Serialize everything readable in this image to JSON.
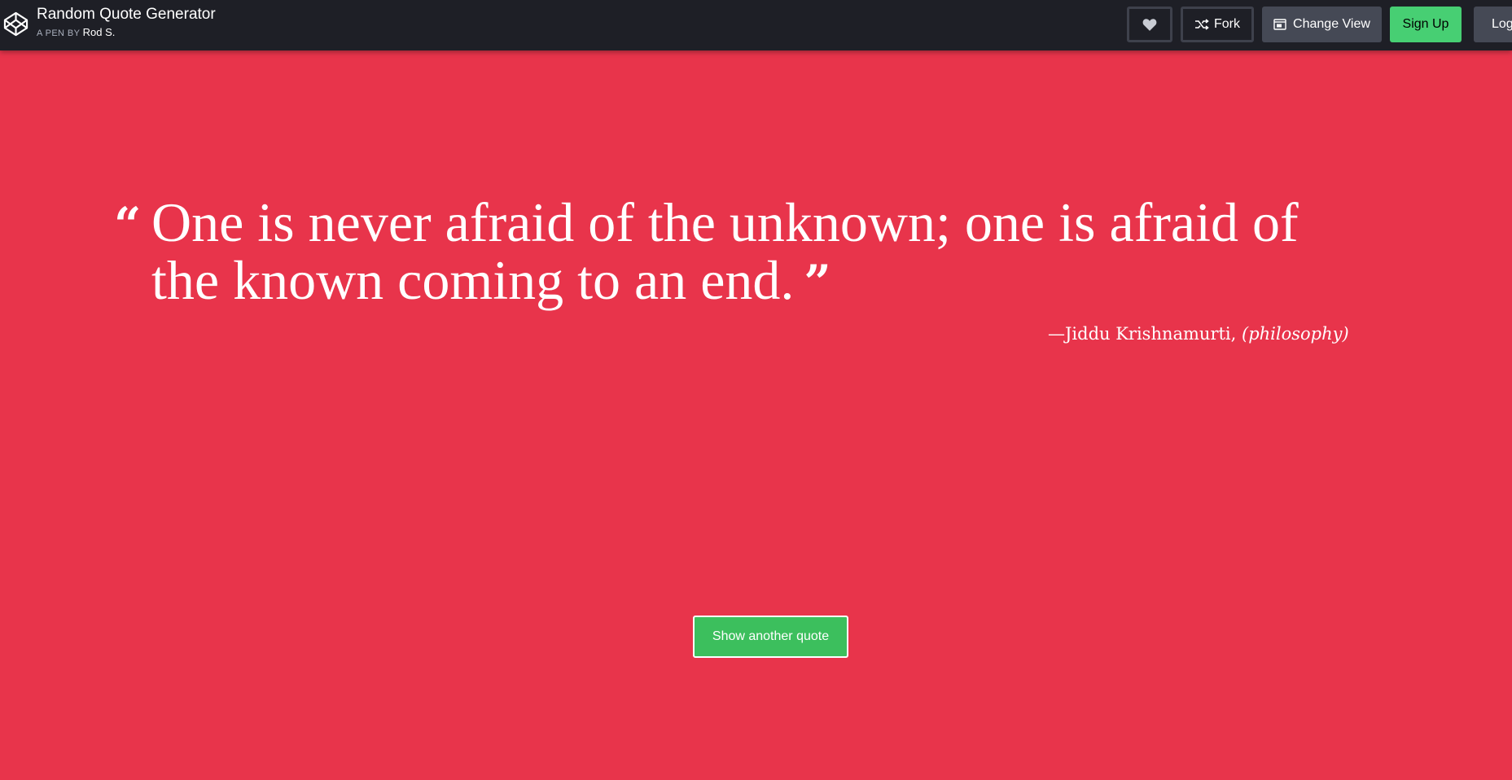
{
  "header": {
    "title": "Random Quote Generator",
    "meta_prefix": "A PEN BY",
    "author": "Rod S.",
    "buttons": {
      "heart_icon": "heart-icon",
      "fork_label": "Fork",
      "change_view_label": "Change View",
      "signup_label": "Sign Up",
      "login_label": "Log"
    }
  },
  "quote": {
    "text": "One is never afraid of the unknown; one is afraid of the known coming to an end.",
    "open_mark": "“",
    "close_mark": "”",
    "author": "—Jiddu Krishnamurti,",
    "category": "(philosophy)"
  },
  "actions": {
    "show_another_label": "Show another quote"
  },
  "colors": {
    "background": "#e8344b",
    "topbar": "#1e1f26",
    "signup": "#47cf73",
    "show_button": "#3cbf5d"
  }
}
